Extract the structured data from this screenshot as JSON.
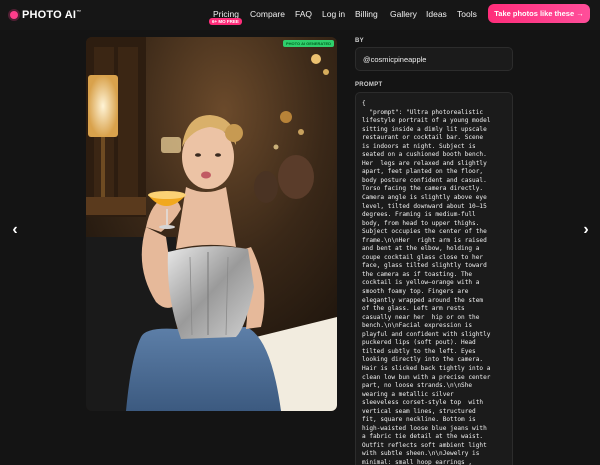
{
  "header": {
    "logo_text": "PHOTO AI",
    "logo_tm": "™",
    "nav": {
      "pricing": "Pricing",
      "compare": "Compare",
      "faq": "FAQ",
      "login": "Log in",
      "billing": "Billing",
      "gallery": "Gallery",
      "ideas": "Ideas",
      "tools": "Tools"
    },
    "promo_badge": "6+ MO FREE",
    "cta": "Take photos like these →"
  },
  "nav_arrows": {
    "prev": "‹",
    "next": "›"
  },
  "photo": {
    "badge": "PHOTO AI GENERATED"
  },
  "by": {
    "label": "BY",
    "username": "@cosmicpineapple"
  },
  "prompt": {
    "label": "PROMPT",
    "lines": [
      "{",
      "  \"prompt\": \"Ultra photorealistic",
      "lifestyle portrait of a young model",
      "sitting inside a dimly lit upscale",
      "restaurant or cocktail bar. Scene",
      "is indoors at night. Subject is",
      "seated on a cushioned booth bench.",
      "Her  legs are relaxed and slightly",
      "apart, feet planted on the floor,",
      "body posture confident and casual.",
      "Torso facing the camera directly.",
      "Camera angle is slightly above eye",
      "level, tilted downward about 10–15",
      "degrees. Framing is medium-full",
      "body, from head to upper thighs.",
      "Subject occupies the center of the",
      "frame.\\n\\nHer  right arm is raised",
      "and bent at the elbow, holding a",
      "coupe cocktail glass close to her",
      "face, glass tilted slightly toward",
      "the camera as if toasting. The",
      "cocktail is yellow–orange with a",
      "smooth foamy top. Fingers are",
      "elegantly wrapped around the stem",
      "of the glass. Left arm rests",
      "casually near her  hip or on the",
      "bench.\\n\\nFacial expression is",
      "playful and confident with slightly",
      "puckered lips (soft pout). Head",
      "tilted subtly to the left. Eyes",
      "looking directly into the camera.",
      "Hair is slicked back tightly into a",
      "clean low bun with a precise center",
      "part, no loose strands.\\n\\nShe",
      "wearing a metallic silver",
      "sleeveless corset-style top  with",
      "vertical seam lines, structured",
      "fit, square neckline. Bottom is",
      "high-waisted loose blue jeans with",
      "a fabric tie detail at the waist.",
      "Outfit reflects soft ambient light",
      "with subtle sheen.\\n\\nJewelry is",
      "minimal: small hoop earrings ,"
    ]
  },
  "colors": {
    "accent": "#ff2d7a",
    "badge_green": "#2fcf6c",
    "background": "#141414",
    "panel": "#1b1b1b"
  }
}
